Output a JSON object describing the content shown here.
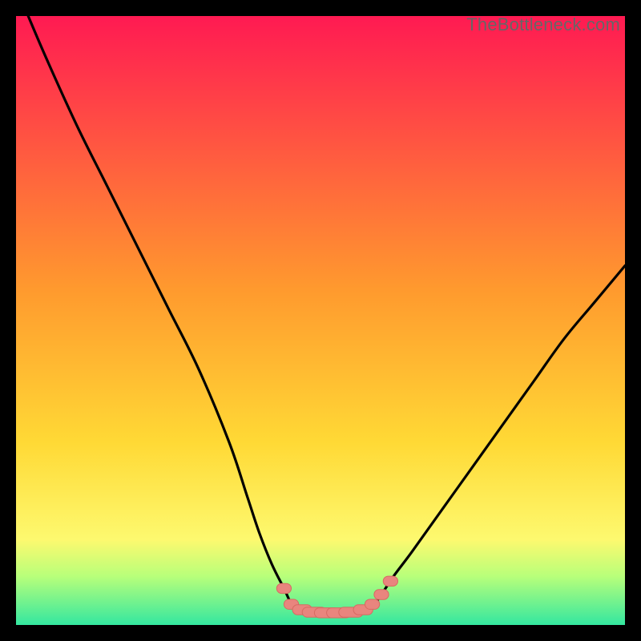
{
  "watermark": {
    "text": "TheBottleneck.com"
  },
  "colors": {
    "frame": "#000000",
    "curve": "#000000",
    "marker_fill": "#e9857e",
    "marker_stroke": "#d86a62",
    "bottom_band_top": "#b8ff7a",
    "bottom_band_bottom": "#34e7a0",
    "grad_top": "#ff1a52",
    "grad_mid": "#ffd935",
    "grad_low": "#fdf96f"
  },
  "chart_data": {
    "type": "line",
    "title": "",
    "xlabel": "",
    "ylabel": "",
    "xlim": [
      0,
      100
    ],
    "ylim": [
      0,
      100
    ],
    "legend": false,
    "grid": false,
    "notes": "Bottleneck-style V-curve. Gradient background red→yellow→green (top→bottom). No axis ticks or numeric labels are visible. Series values are approximate bottleneck-percent read from vertical position (0 = bottom/green, 100 = top/red).",
    "series": [
      {
        "name": "left-branch",
        "x": [
          2,
          5,
          10,
          15,
          20,
          25,
          30,
          35,
          38,
          40,
          42,
          44,
          45.5
        ],
        "values": [
          100,
          93,
          82,
          72,
          62,
          52,
          42,
          30,
          21,
          15,
          10,
          6,
          3
        ]
      },
      {
        "name": "valley",
        "x": [
          45.5,
          47,
          49,
          51,
          53,
          55,
          57,
          58.5
        ],
        "values": [
          3,
          2.3,
          2.0,
          2.0,
          2.0,
          2.0,
          2.3,
          3
        ]
      },
      {
        "name": "right-branch",
        "x": [
          58.5,
          60,
          62,
          65,
          70,
          75,
          80,
          85,
          90,
          95,
          100
        ],
        "values": [
          3,
          5,
          8,
          12,
          19,
          26,
          33,
          40,
          47,
          53,
          59
        ]
      }
    ],
    "markers": {
      "name": "highlighted-points",
      "subtype": "pill",
      "x": [
        44,
        45.2,
        47,
        49,
        51,
        53,
        55,
        57,
        58.5,
        60,
        61.5
      ],
      "values": [
        6,
        3.4,
        2.5,
        2.1,
        2.0,
        2.0,
        2.1,
        2.5,
        3.4,
        5.0,
        7.2
      ],
      "widths": [
        1.2,
        1.2,
        1.6,
        2.0,
        2.0,
        2.0,
        2.0,
        1.6,
        1.2,
        1.2,
        1.2
      ]
    },
    "background_gradient": {
      "stops": [
        {
          "pos": 0.0,
          "color": "#ff1a52"
        },
        {
          "pos": 0.45,
          "color": "#ff9a2e"
        },
        {
          "pos": 0.7,
          "color": "#ffd935"
        },
        {
          "pos": 0.86,
          "color": "#fdf96f"
        },
        {
          "pos": 0.92,
          "color": "#b8ff7a"
        },
        {
          "pos": 1.0,
          "color": "#34e7a0"
        }
      ]
    }
  }
}
